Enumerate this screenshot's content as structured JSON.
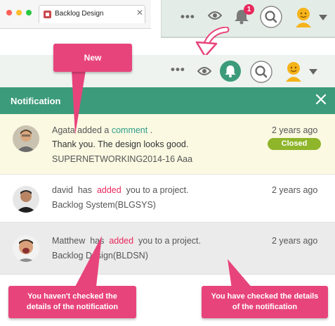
{
  "browser": {
    "tab_title": "Backlog Design",
    "tab_close": "✕",
    "traffic_light_colors": [
      "#fd5f57",
      "#febc2e",
      "#28c840"
    ]
  },
  "top_bar": {
    "more_label": "•••",
    "notification_count": "1"
  },
  "second_bar": {
    "more_label": "•••"
  },
  "panel": {
    "title": "Notification",
    "close_symbol": "✕",
    "items": [
      {
        "user": "Agata",
        "verb": "added a",
        "object": "comment",
        "suffix": ".",
        "message": "Thank you. The design looks good.",
        "reference": "SUPERNETWORKING2014-16 Aaa",
        "time": "2 years ago",
        "status": "Closed"
      },
      {
        "user": "david",
        "verb_pre": "has",
        "verb": "added",
        "suffix": "you to a project.",
        "reference": "Backlog System(BLGSYS)",
        "time": "2 years ago"
      },
      {
        "user": "Matthew",
        "verb_pre": "has",
        "verb": "added",
        "suffix": "you to a project.",
        "reference": "Backlog Design(BLDSN)",
        "time": "2 years ago"
      }
    ]
  },
  "callouts": {
    "new": "New",
    "unchecked": "You haven't checked the details of the notification",
    "checked": "You have checked the details of the notification"
  },
  "colors": {
    "brand_green": "#3c9b7b",
    "accent_pink": "#e8285d",
    "callout_pink": "#e8447c",
    "closed_green": "#8fb52b",
    "new_item_bg": "#fbf9e2",
    "read_item_bg": "#ebebeb"
  },
  "icons": [
    "more-icon",
    "eye-icon",
    "bell-icon",
    "search-icon",
    "avatar-icon",
    "chevron-down-icon",
    "close-icon",
    "arrow-down-icon"
  ]
}
